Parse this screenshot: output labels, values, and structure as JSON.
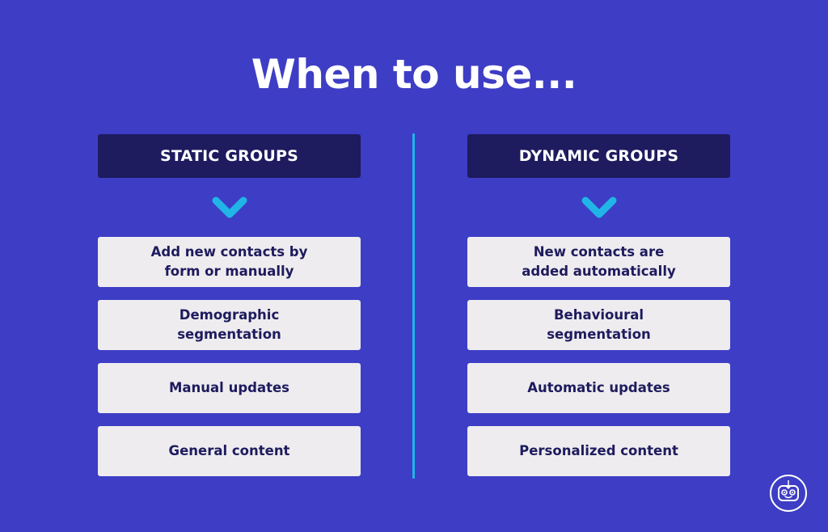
{
  "title": "When to use...",
  "colors": {
    "background": "#3e3dc5",
    "header_bg": "#1e1b5e",
    "item_bg": "#eeecee",
    "accent": "#20b5e6",
    "item_text": "#1e1b5e"
  },
  "columns": [
    {
      "header": "STATIC GROUPS",
      "icon": "chevron-down-icon",
      "items": [
        "Add new contacts by form or manually",
        "Demographic segmentation",
        "Manual updates",
        "General content"
      ]
    },
    {
      "header": "DYNAMIC GROUPS",
      "icon": "chevron-down-icon",
      "items": [
        "New contacts are added automatically",
        "Behavioural segmentation",
        "Automatic updates",
        "Personalized content"
      ]
    }
  ],
  "logo": "robot-logo-icon"
}
